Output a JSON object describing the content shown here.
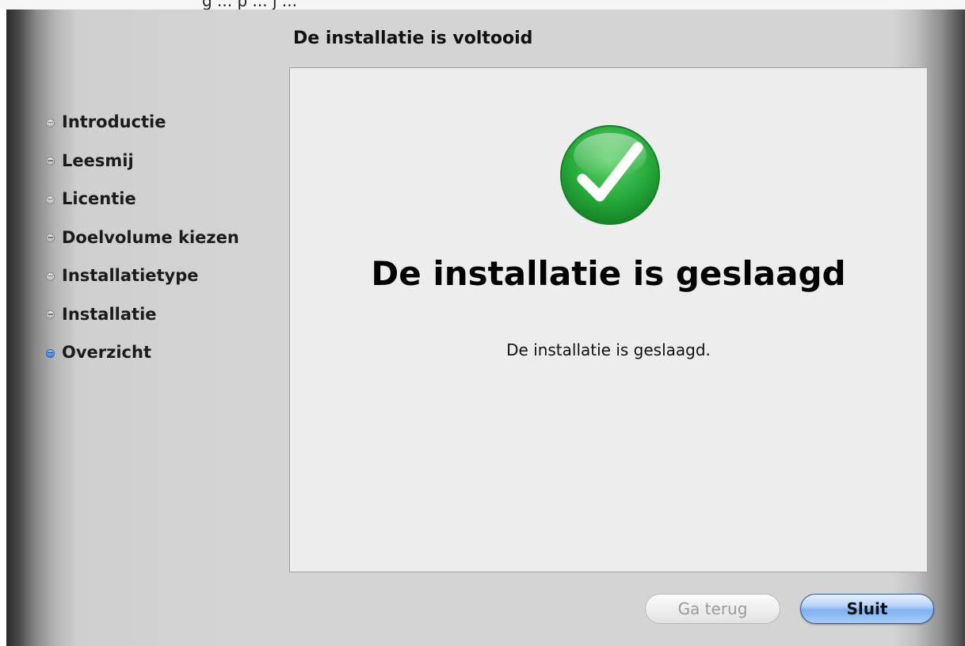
{
  "top_strip": {
    "text": "g ... p ... j ..."
  },
  "window": {
    "page_title": "De installatie is voltooid"
  },
  "sidebar": {
    "steps": [
      {
        "label": "Introductie",
        "active": false
      },
      {
        "label": "Leesmij",
        "active": false
      },
      {
        "label": "Licentie",
        "active": false
      },
      {
        "label": "Doelvolume kiezen",
        "active": false
      },
      {
        "label": "Installatietype",
        "active": false
      },
      {
        "label": "Installatie",
        "active": false
      },
      {
        "label": "Overzicht",
        "active": true
      }
    ]
  },
  "content": {
    "icon": "checkmark-icon",
    "headline": "De installatie is geslaagd",
    "message": "De installatie is geslaagd."
  },
  "buttons": {
    "back_label": "Ga terug",
    "back_enabled": false,
    "close_label": "Sluit"
  },
  "colors": {
    "accent_blue": "#3f79d6",
    "success_green": "#2bb24c"
  }
}
